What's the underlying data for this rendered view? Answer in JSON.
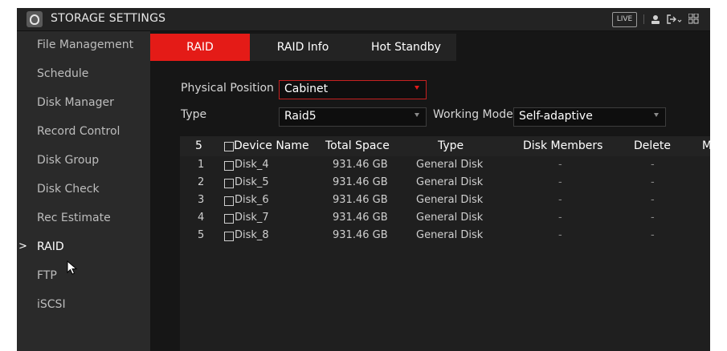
{
  "header": {
    "title": "STORAGE SETTINGS",
    "live_label": "LIVE"
  },
  "sidebar": {
    "items": [
      {
        "label": "File Management"
      },
      {
        "label": "Schedule"
      },
      {
        "label": "Disk Manager"
      },
      {
        "label": "Record Control"
      },
      {
        "label": "Disk Group"
      },
      {
        "label": "Disk Check"
      },
      {
        "label": "Rec Estimate"
      },
      {
        "label": "RAID",
        "active": true
      },
      {
        "label": "FTP"
      },
      {
        "label": "iSCSI"
      }
    ],
    "active_marker": ">"
  },
  "tabs": [
    {
      "label": "RAID",
      "active": true
    },
    {
      "label": "RAID Info"
    },
    {
      "label": "Hot Standby"
    }
  ],
  "form": {
    "physical_position_label": "Physical Position",
    "physical_position_value": "Cabinet",
    "type_label": "Type",
    "type_value": "Raid5",
    "working_mode_label": "Working Mode",
    "working_mode_value": "Self-adaptive"
  },
  "table": {
    "count": "5",
    "headers": [
      "Device Name",
      "Total Space",
      "Type",
      "Disk Members",
      "Delete",
      "M"
    ],
    "rows": [
      {
        "index": "1",
        "name": "Disk_4",
        "space": "931.46 GB",
        "type": "General Disk",
        "members": "-",
        "delete": "-"
      },
      {
        "index": "2",
        "name": "Disk_5",
        "space": "931.46 GB",
        "type": "General Disk",
        "members": "-",
        "delete": "-"
      },
      {
        "index": "3",
        "name": "Disk_6",
        "space": "931.46 GB",
        "type": "General Disk",
        "members": "-",
        "delete": "-"
      },
      {
        "index": "4",
        "name": "Disk_7",
        "space": "931.46 GB",
        "type": "General Disk",
        "members": "-",
        "delete": "-"
      },
      {
        "index": "5",
        "name": "Disk_8",
        "space": "931.46 GB",
        "type": "General Disk",
        "members": "-",
        "delete": "-"
      }
    ]
  },
  "colors": {
    "accent": "#e41b17",
    "background": "#161616",
    "sidebar": "#2a2a2a"
  },
  "icons": {
    "logo": "dvr-logo-icon",
    "user": "user-icon",
    "logout": "logout-icon",
    "menu": "grid-menu-icon",
    "cursor": "mouse-cursor-icon"
  }
}
